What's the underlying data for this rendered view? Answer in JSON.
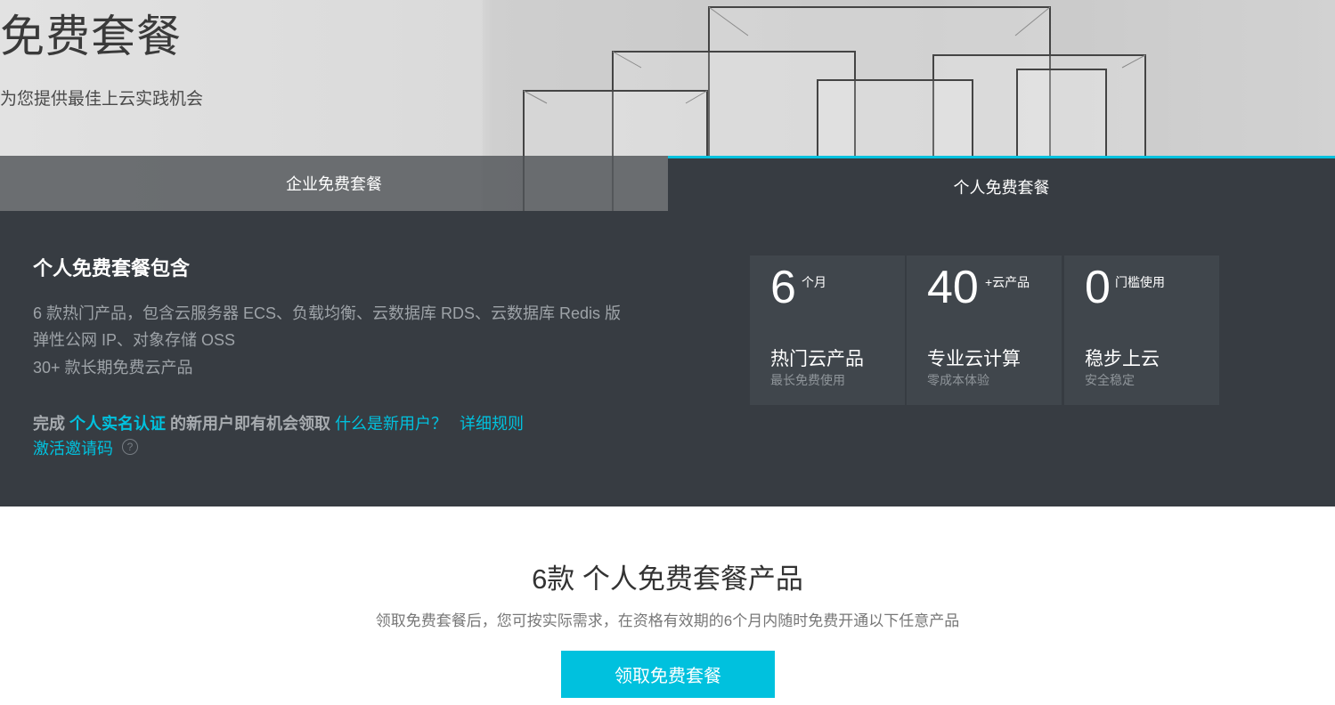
{
  "hero": {
    "title": "免费套餐",
    "subtitle": "为您提供最佳上云实践机会"
  },
  "tabs": [
    {
      "label": "企业免费套餐",
      "active": false
    },
    {
      "label": "个人免费套餐",
      "active": true
    }
  ],
  "panel": {
    "title": "个人免费套餐包含",
    "desc_lines": [
      "6  款热门产品，包含云服务器 ECS、负载均衡、云数据库 RDS、云数据库 Redis 版",
      "弹性公网 IP、对象存储 OSS",
      "30+ 款长期免费云产品"
    ],
    "claim_prefix": "完成 ",
    "claim_highlight": "个人实名认证",
    "claim_suffix": " 的新用户即有机会领取",
    "links": {
      "what_is_new_user": "什么是新用户？",
      "detail_rules": "详细规则",
      "activate_code": "激活邀请码"
    },
    "help_icon": "?"
  },
  "stats": [
    {
      "num": "6",
      "unit": "个月",
      "label": "热门云产品",
      "sublabel": "最长免费使用"
    },
    {
      "num": "40",
      "unit": "+云产品",
      "label": "专业云计算",
      "sublabel": "零成本体验"
    },
    {
      "num": "0",
      "unit": "门槛使用",
      "label": "稳步上云",
      "sublabel": "安全稳定"
    }
  ],
  "products_section": {
    "title": "6款 个人免费套餐产品",
    "subtitle": "领取免费套餐后，您可按实际需求，在资格有效期的6个月内随时免费开通以下任意产品",
    "button_label": "领取免费套餐"
  },
  "colors": {
    "accent": "#00c1de",
    "panel_bg": "#373c42",
    "stat_bg": "#40464c"
  }
}
